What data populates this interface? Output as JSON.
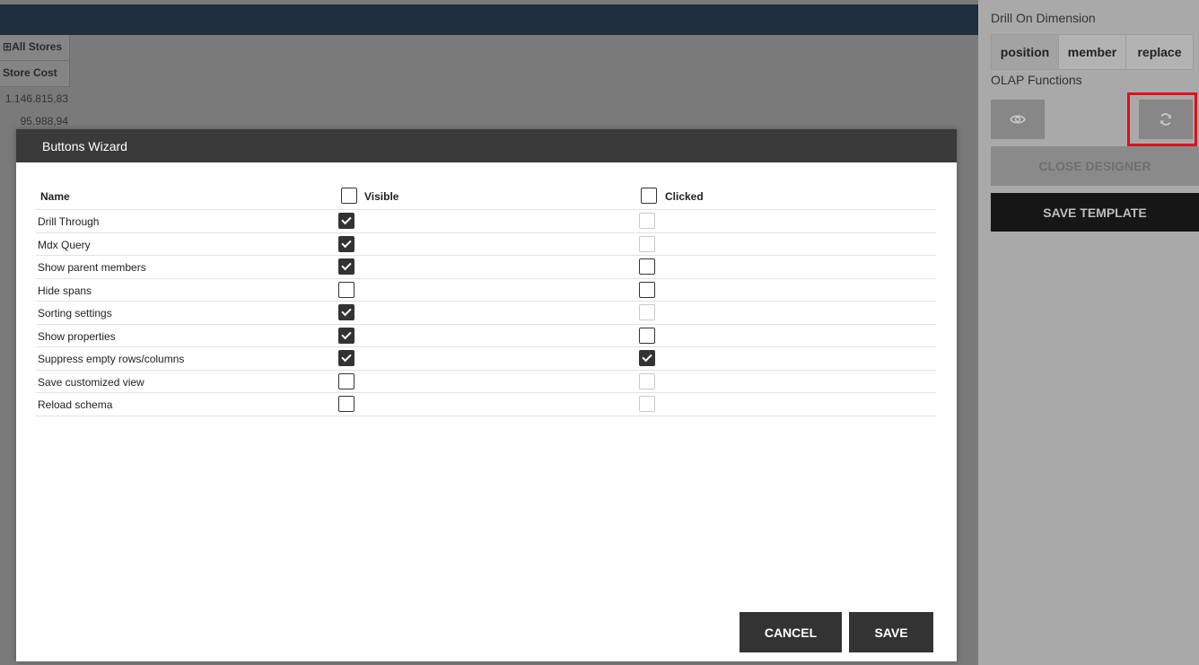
{
  "background": {
    "pivot_header": "All Stores",
    "pivot_measure": "Store Cost",
    "values": [
      "1.146.815,83",
      "95.988,94"
    ]
  },
  "panel": {
    "drill_label": "Drill On Dimension",
    "drill_options": [
      "position",
      "member",
      "replace"
    ],
    "olap_label": "OLAP Functions",
    "close_designer": "CLOSE DESIGNER",
    "save_template": "SAVE TEMPLATE",
    "icons": {
      "view": "eye-icon",
      "refresh": "refresh-icon"
    },
    "highlight_color": "#e0101b"
  },
  "dialog": {
    "title": "Buttons Wizard",
    "columns": {
      "name": "Name",
      "visible": "Visible",
      "clicked": "Clicked"
    },
    "rows": [
      {
        "name": "Drill Through",
        "visible": true,
        "clicked": false,
        "clicked_disabled": true
      },
      {
        "name": "Mdx Query",
        "visible": true,
        "clicked": false,
        "clicked_disabled": true
      },
      {
        "name": "Show parent members",
        "visible": true,
        "clicked": false,
        "clicked_disabled": false
      },
      {
        "name": "Hide spans",
        "visible": false,
        "clicked": false,
        "clicked_disabled": false
      },
      {
        "name": "Sorting settings",
        "visible": true,
        "clicked": false,
        "clicked_disabled": true
      },
      {
        "name": "Show properties",
        "visible": true,
        "clicked": false,
        "clicked_disabled": false
      },
      {
        "name": "Suppress empty rows/columns",
        "visible": true,
        "clicked": true,
        "clicked_disabled": false
      },
      {
        "name": "Save customized view",
        "visible": false,
        "clicked": false,
        "clicked_disabled": true
      },
      {
        "name": "Reload schema",
        "visible": false,
        "clicked": false,
        "clicked_disabled": true
      }
    ],
    "cancel_label": "CANCEL",
    "save_label": "SAVE"
  }
}
